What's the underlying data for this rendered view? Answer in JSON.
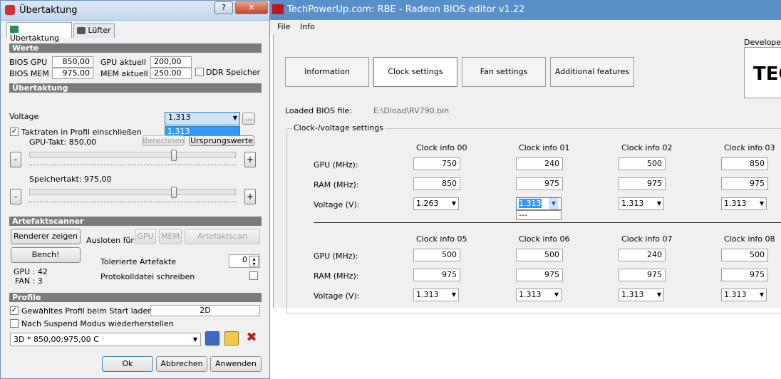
{
  "left_window": {
    "title": "Übertaktung",
    "help_btn": "?",
    "close_btn": "✕",
    "tabs": [
      "Übertaktung",
      "Lüfter"
    ],
    "werte": {
      "header": "Werte",
      "bios_gpu_label": "BIOS GPU",
      "bios_gpu_value": "850,00",
      "bios_mem_label": "BIOS MEM",
      "bios_mem_value": "975,00",
      "gpu_aktuell_label": "GPU aktuell",
      "gpu_aktuell_value": "200,00",
      "mem_aktuell_label": "MEM aktuell",
      "mem_aktuell_value": "250,00",
      "ddr_label": "DDR Speicher"
    },
    "uebertaktung": {
      "header": "Übertaktung",
      "voltage_label": "Voltage",
      "voltage_value": "1,313",
      "voltage_dropdown_option": "1,313",
      "ellipsis": "...",
      "taktraten_label": "Taktraten in Profil einschließen",
      "berechnen": "Berechnen",
      "ursprungswerte": "Ursprungswerte",
      "gpu_takt_label": "GPU-Takt: 850,00",
      "speicher_takt_label": "Speichertakt: 975,00",
      "minus": "-",
      "plus": "+",
      "gpu_slider_fraction": 0.7,
      "mem_slider_fraction": 0.7
    },
    "artefakt": {
      "header": "Artefaktscanner",
      "renderer_btn": "Renderer zeigen",
      "ausloten_label": "Ausloten für",
      "gpu_btn": "GPU",
      "mem_btn": "MEM",
      "scan_btn": "Artefaktscan",
      "bench_btn": "Bench!",
      "tolerierte_label": "Tolerierte Artefakte",
      "tolerierte_value": "0",
      "protokoll_label": "Protokolldatei schreiben",
      "gpu_temp": "GPU : 42",
      "fan": "FAN : 3"
    },
    "profile": {
      "header": "Profile",
      "gewaehltes_label": "Gewähltes Profil beim Start laden",
      "profil_value": "2D",
      "suspend_label": "Nach Suspend Modus wiederherstellen",
      "profile_select": "3D * 850,00;975,00 C"
    },
    "buttons": {
      "ok": "Ok",
      "abbrechen": "Abbrechen",
      "anwenden": "Anwenden"
    }
  },
  "right_window": {
    "title": "TechPowerUp.com: RBE - Radeon BIOS editor v1.22",
    "menu": [
      "File",
      "Info"
    ],
    "tabs": [
      "Information",
      "Clock settings",
      "Fan settings",
      "Additional features"
    ],
    "developed": "Developed",
    "logo_text": "TEC",
    "loaded_label": "Loaded BIOS file:",
    "loaded_path": "E:\\Dload\\RV790.bin",
    "group_label": "Clock-/voltage settings",
    "row_labels": {
      "gpu": "GPU (MHz):",
      "ram": "RAM (MHz):",
      "voltage": "Voltage (V):"
    },
    "clock_infos": [
      {
        "name": "Clock info 00",
        "gpu": "750",
        "ram": "850",
        "voltage": "1.263"
      },
      {
        "name": "Clock info 01",
        "gpu": "240",
        "ram": "975",
        "voltage": "1.313"
      },
      {
        "name": "Clock info 02",
        "gpu": "500",
        "ram": "975",
        "voltage": "1.313"
      },
      {
        "name": "Clock info 03",
        "gpu": "850",
        "ram": "975",
        "voltage": "1.313"
      },
      {
        "name": "Clock info 05",
        "gpu": "500",
        "ram": "975",
        "voltage": "1.313"
      },
      {
        "name": "Clock info 06",
        "gpu": "500",
        "ram": "975",
        "voltage": "1.313"
      },
      {
        "name": "Clock info 07",
        "gpu": "240",
        "ram": "975",
        "voltage": "1.313"
      },
      {
        "name": "Clock info 08",
        "gpu": "500",
        "ram": "975",
        "voltage": "1.313"
      }
    ],
    "voltage_dropdown_item": "---"
  }
}
